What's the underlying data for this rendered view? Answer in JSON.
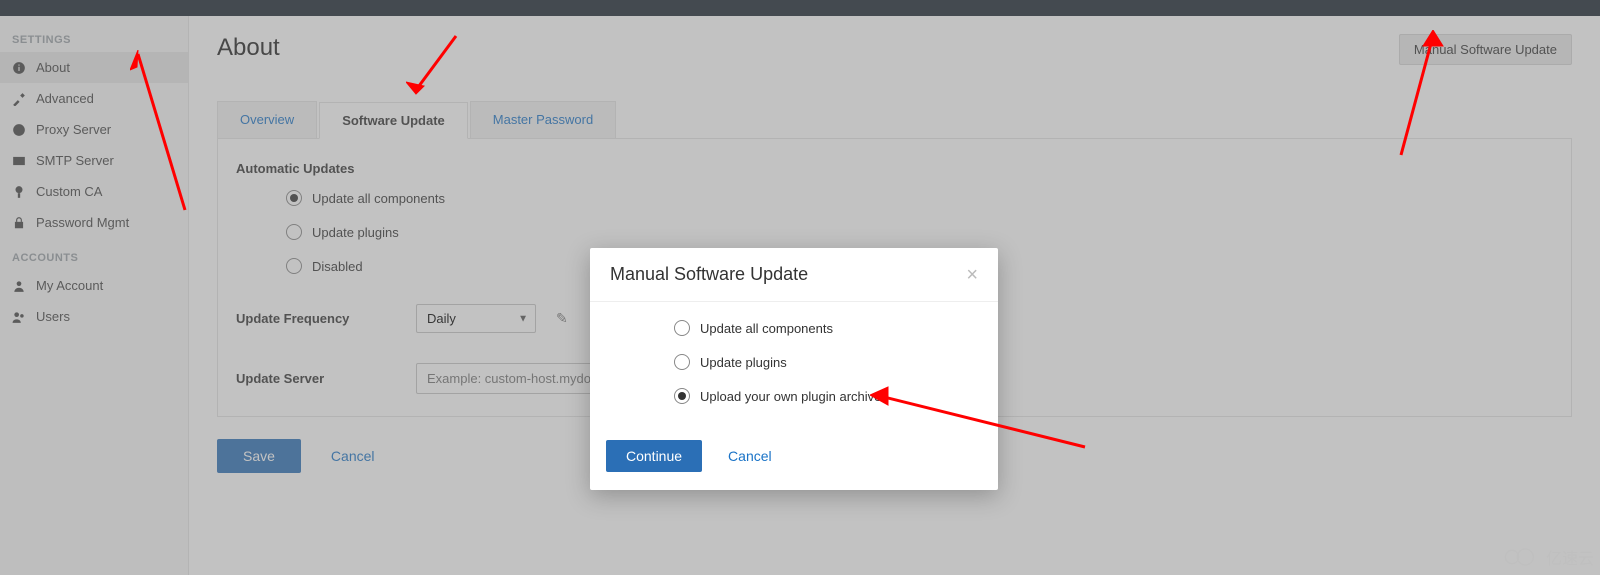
{
  "sidebar": {
    "section_settings": "SETTINGS",
    "section_accounts": "ACCOUNTS",
    "items_settings": [
      {
        "label": "About",
        "active": true
      },
      {
        "label": "Advanced"
      },
      {
        "label": "Proxy Server"
      },
      {
        "label": "SMTP Server"
      },
      {
        "label": "Custom CA"
      },
      {
        "label": "Password Mgmt"
      }
    ],
    "items_accounts": [
      {
        "label": "My Account"
      },
      {
        "label": "Users"
      }
    ]
  },
  "page": {
    "title": "About",
    "manual_update_button": "Manual Software Update"
  },
  "tabs": [
    {
      "label": "Overview"
    },
    {
      "label": "Software Update",
      "active": true
    },
    {
      "label": "Master Password"
    }
  ],
  "auto_updates": {
    "heading": "Automatic Updates",
    "options": [
      {
        "label": "Update all components",
        "selected": true
      },
      {
        "label": "Update plugins"
      },
      {
        "label": "Disabled"
      }
    ]
  },
  "freq": {
    "label": "Update Frequency",
    "value": "Daily"
  },
  "server": {
    "label": "Update Server",
    "placeholder": "Example: custom-host.mydomain.com"
  },
  "actions": {
    "save": "Save",
    "cancel": "Cancel"
  },
  "modal": {
    "title": "Manual Software Update",
    "options": [
      {
        "label": "Update all components"
      },
      {
        "label": "Update plugins"
      },
      {
        "label": "Upload your own plugin archive",
        "selected": true
      }
    ],
    "continue": "Continue",
    "cancel": "Cancel"
  },
  "watermark": "亿速云"
}
